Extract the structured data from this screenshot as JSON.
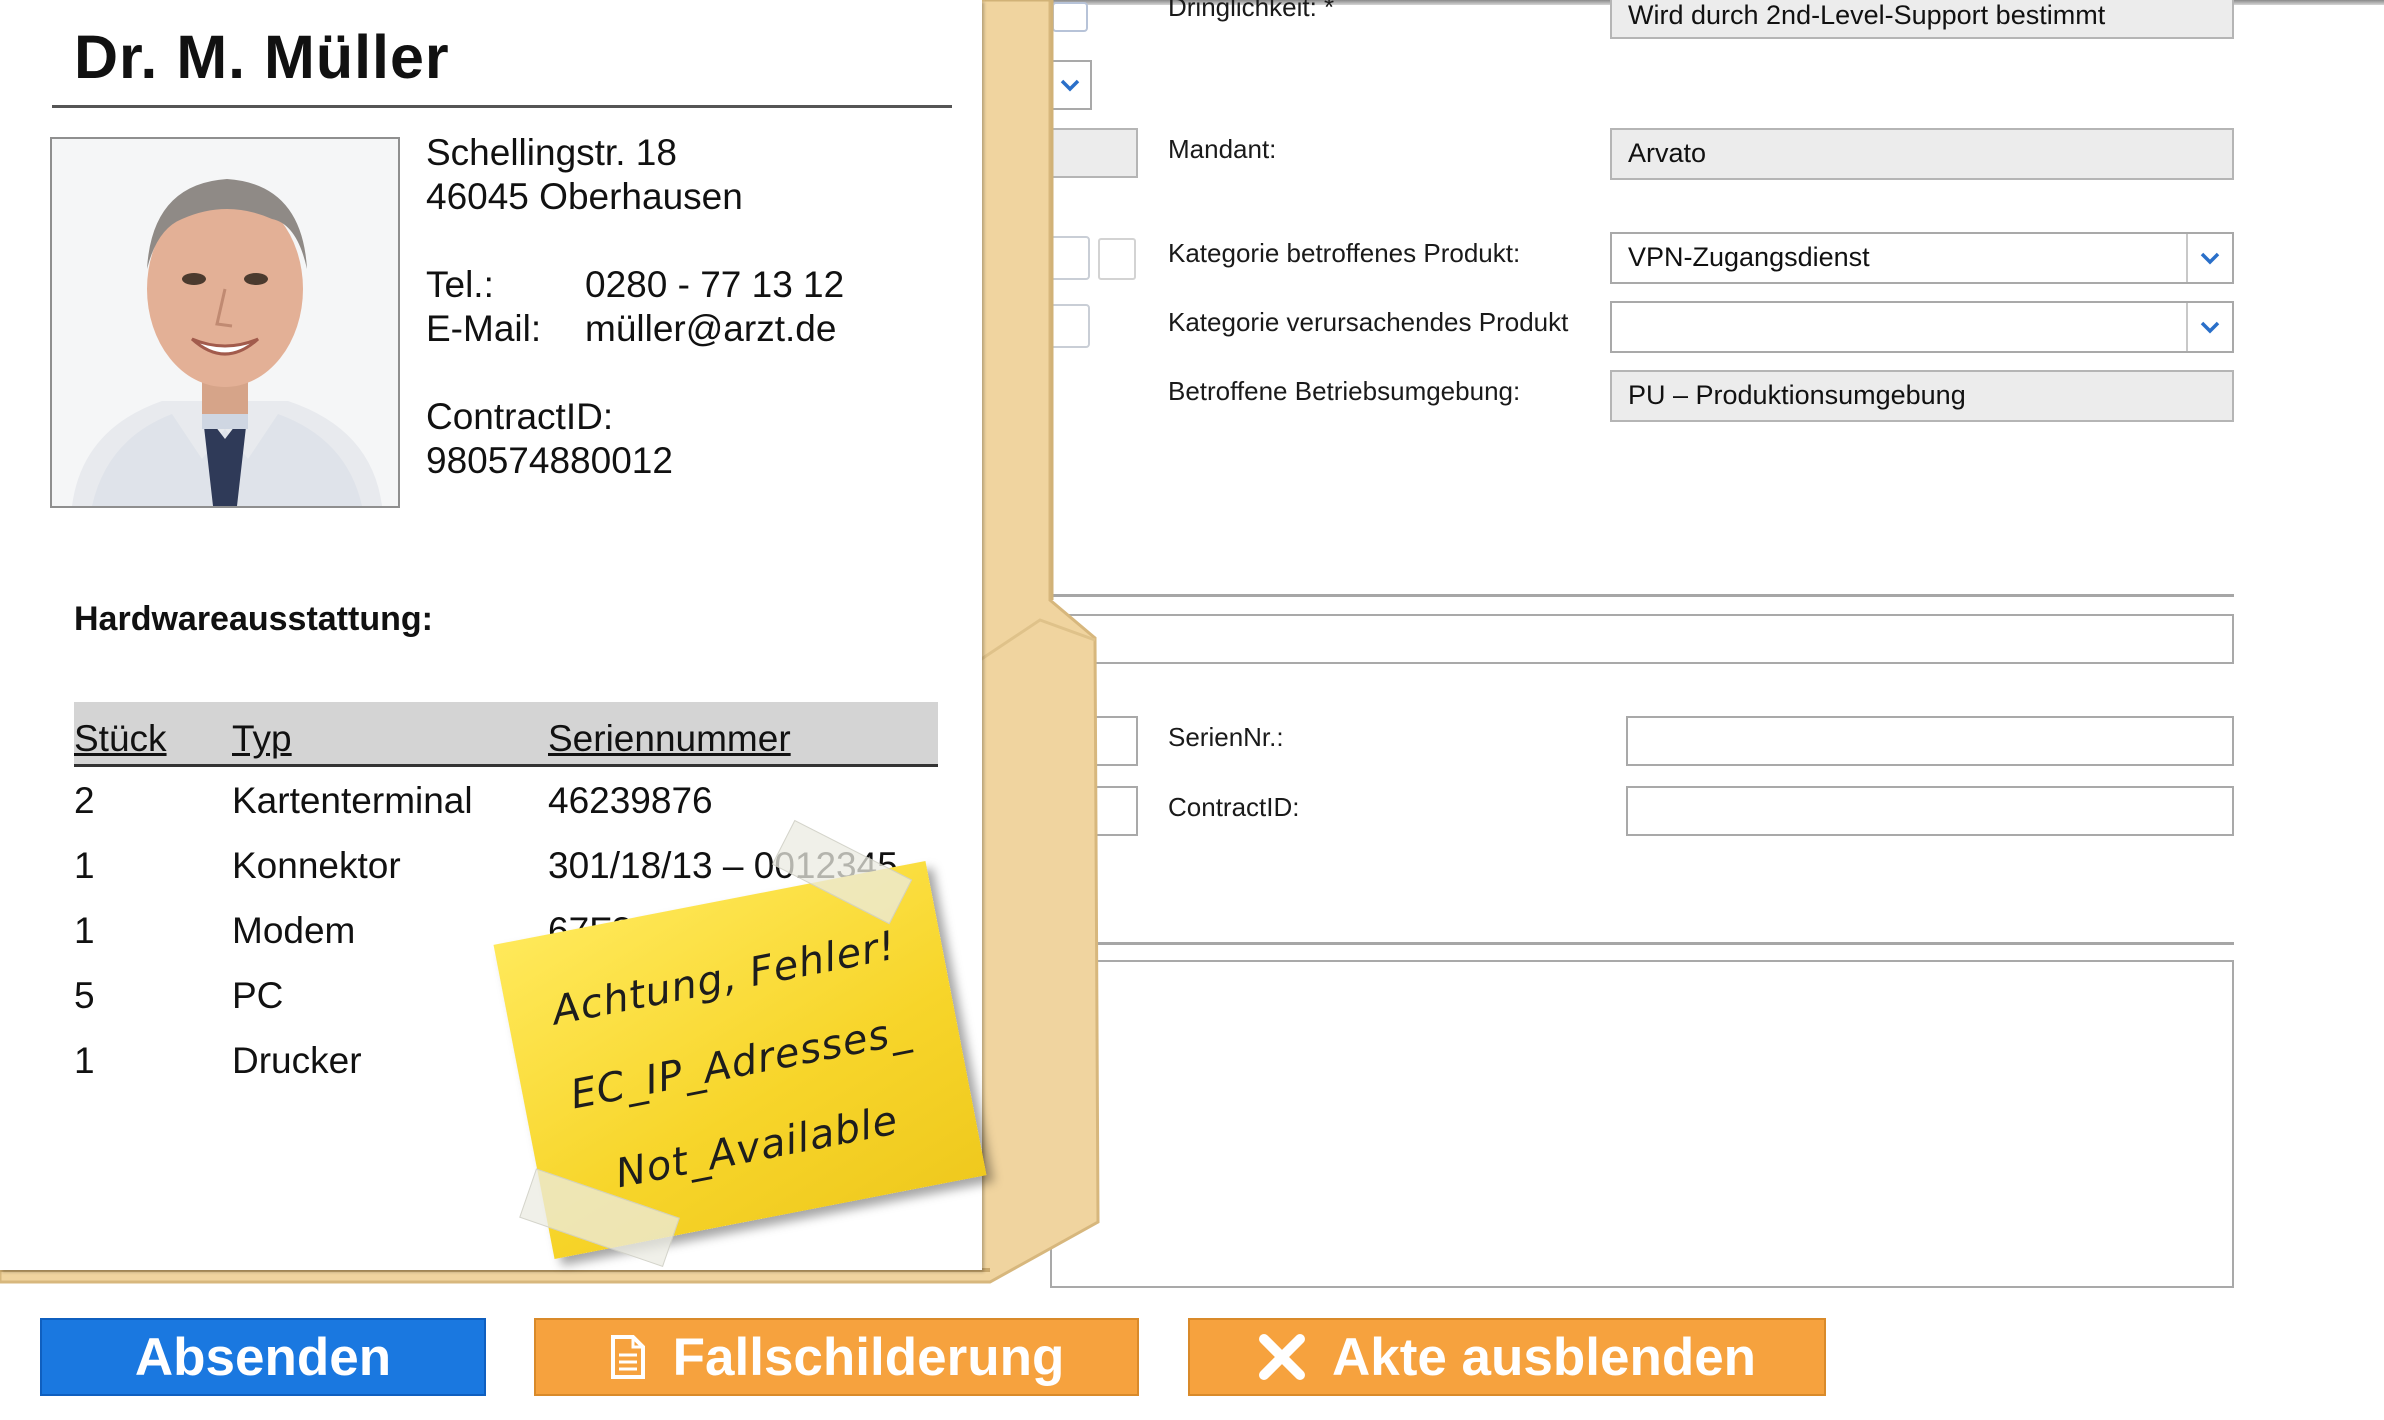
{
  "form": {
    "dringlichkeit_label": "Dringlichkeit: *",
    "dringlichkeit_value": "Wird durch 2nd-Level-Support bestimmt",
    "mandant_label": "Mandant:",
    "mandant_value": "Arvato",
    "kategorie_betroffen_label": "Kategorie betroffenes Produkt:",
    "kategorie_betroffen_value": "VPN-Zugangsdienst",
    "kategorie_verursachend_label": "Kategorie verursachendes Produkt",
    "kategorie_verursachend_value": "",
    "betriebsumgebung_label": "Betroffene Betriebsumgebung:",
    "betriebsumgebung_value": "PU – Produktionsumgebung",
    "seriennr_label": "SerienNr.:",
    "seriennr_value": "",
    "contractid_label": "ContractID:",
    "contractid_value": ""
  },
  "record": {
    "name": "Dr. M. Müller",
    "street": "Schellingstr. 18",
    "city": "46045 Oberhausen",
    "tel_label": "Tel.:",
    "tel_value": "0280 - 77 13 12",
    "email_label": "E-Mail:",
    "email_value": "müller@arzt.de",
    "contract_label": "ContractID:",
    "contract_value": "980574880012",
    "hardware_title": "Hardwareausstattung:",
    "columns": [
      "Stück",
      "Typ",
      "Seriennummer"
    ],
    "rows": [
      {
        "qty": "2",
        "type": "Kartenterminal",
        "serial": "46239876"
      },
      {
        "qty": "1",
        "type": "Konnektor",
        "serial": "301/18/13 – 0012345"
      },
      {
        "qty": "1",
        "type": "Modem",
        "serial": "67F32-12475"
      },
      {
        "qty": "5",
        "type": "PC",
        "serial": ""
      },
      {
        "qty": "1",
        "type": "Drucker",
        "serial": ""
      }
    ]
  },
  "note": {
    "line1": "Achtung, Fehler!",
    "line2": "EC_IP_Adresses_",
    "line3": "Not_Available"
  },
  "buttons": {
    "send": "Absenden",
    "case": "Fallschilderung",
    "hide": "Akte ausblenden"
  },
  "colors": {
    "send_bg": "#1a78e0",
    "action_bg": "#f6a23e",
    "folder": "#f0d49f",
    "note": "#f7d52a"
  }
}
